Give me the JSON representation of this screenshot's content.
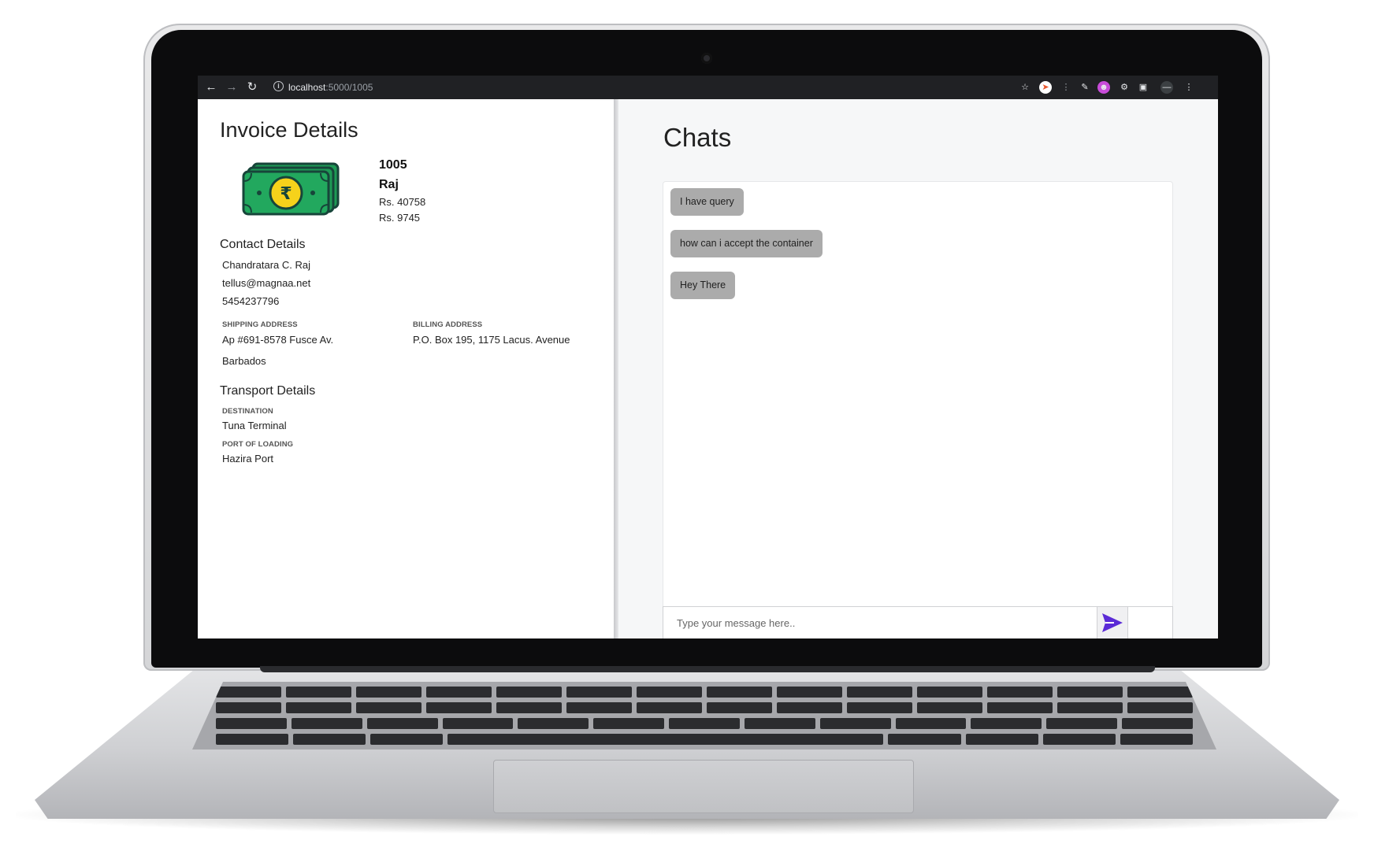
{
  "browser": {
    "url_host": "localhost",
    "url_path": ":5000/1005"
  },
  "invoice": {
    "heading": "Invoice Details",
    "number": "1005",
    "customer": "Raj",
    "amount_1": "Rs. 40758",
    "amount_2": "Rs. 9745"
  },
  "contact": {
    "heading": "Contact Details",
    "name": "Chandratara C. Raj",
    "email": "tellus@magnaa.net",
    "phone": "5454237796"
  },
  "addresses": {
    "shipping_label": "SHIPPING ADDRESS",
    "shipping_line1": "Ap #691-8578 Fusce Av.",
    "shipping_line2": "Barbados",
    "billing_label": "BILLING ADDRESS",
    "billing_line1": "P.O. Box 195, 1175 Lacus. Avenue"
  },
  "transport": {
    "heading": "Transport Details",
    "destination_label": "DESTINATION",
    "destination": "Tuna Terminal",
    "port_label": "PORT OF LOADING",
    "port": "Hazira Port"
  },
  "chats": {
    "heading": "Chats",
    "messages": [
      "I have query",
      "how can i accept the container",
      "Hey There"
    ],
    "input_placeholder": "Type your message here..",
    "send_icon": "send-icon",
    "send_color": "#5b2bd6"
  },
  "colors": {
    "money_green": "#1e9a55",
    "money_dark": "#17453a",
    "coin_yellow": "#f6d21b"
  }
}
